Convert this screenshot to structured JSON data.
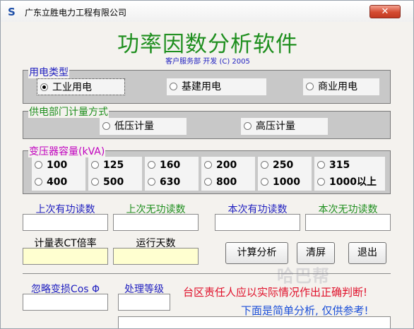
{
  "window": {
    "title": "广东立胜电力工程有限公司",
    "close_label": "✕"
  },
  "header": {
    "heading": "功率因数分析软件",
    "subheading": "客户服务部 开发 (C) 2005"
  },
  "usage": {
    "label": "用电类型",
    "options": [
      "工业用电",
      "基建用电",
      "商业用电"
    ],
    "selected": "工业用电"
  },
  "metering": {
    "label": "供电部门计量方式",
    "options": [
      "低压计量",
      "高压计量"
    ]
  },
  "capacity": {
    "label": "变压器容量(kVA)",
    "row1": [
      "100",
      "125",
      "160",
      "200",
      "250",
      "315"
    ],
    "row2": [
      "400",
      "500",
      "630",
      "800",
      "1000",
      "1000以上"
    ]
  },
  "fields": {
    "last_active": "上次有功读数",
    "last_reactive": "上次无功读数",
    "curr_active": "本次有功读数",
    "curr_reactive": "本次无功读数",
    "ct_ratio": "计量表CT倍率",
    "run_days": "运行天数",
    "ignore_cos": "忽略变损Cos Φ",
    "level": "处理等级"
  },
  "buttons": {
    "calculate": "计算分析",
    "clear": "清屏",
    "exit": "退出"
  },
  "notes": {
    "warning": "台区责任人应以实际情况作出正确判断!",
    "info": "下面是简单分析, 仅供参考!"
  },
  "colors": {
    "heading": "#1f8f1f",
    "blue_label": "#2020c0",
    "green_label": "#1f8f1f",
    "purple_label": "#c000c0",
    "warning": "#e0102a",
    "info": "#1b4fd8"
  }
}
